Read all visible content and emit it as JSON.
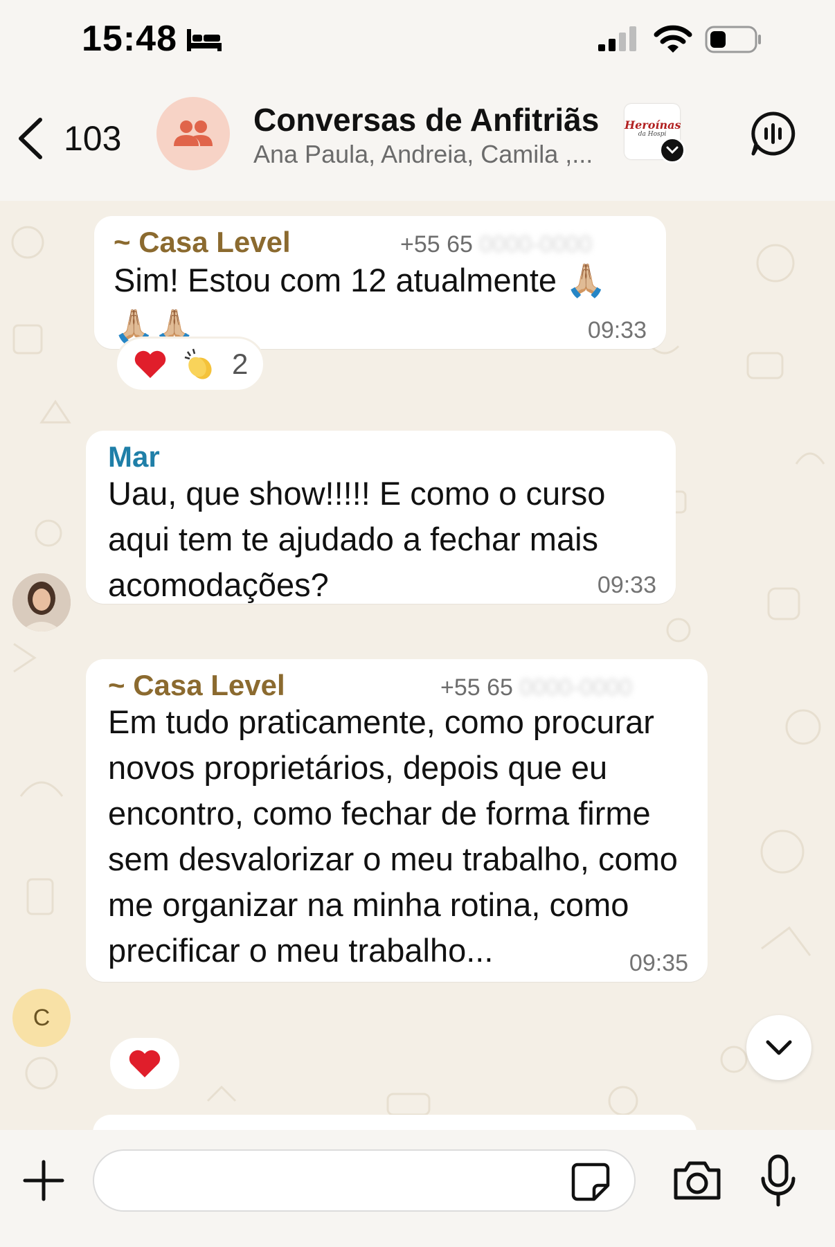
{
  "status_bar": {
    "time": "15:48"
  },
  "header": {
    "back_count": "103",
    "title": "Conversas de Anfitriãs",
    "members": "Ana Paula, Andreia, Camila ,...",
    "logo_text": "Heroínas",
    "logo_subtext": "da Hospi"
  },
  "messages": [
    {
      "sender": "~ Casa Level",
      "phone_visible": "+55 65 ",
      "phone_hidden": "0000-0000",
      "text": "Sim! Estou com 12 atualmente 🙏🏼 🙏🏼🙏🏼",
      "time": "09:33",
      "reactions": {
        "count": "2",
        "icons": [
          "heart-emoji",
          "clapping-emoji"
        ]
      }
    },
    {
      "sender": "Mar",
      "text": "Uau, que show!!!!! E como o curso aqui tem te ajudado a fechar mais acomodações?",
      "time": "09:33"
    },
    {
      "sender": "~ Casa Level",
      "phone_visible": "+55 65 ",
      "phone_hidden": "0000-0000",
      "text": "Em tudo praticamente, como procurar novos proprietários, depois que eu encontro, como fechar de forma firme sem desvalorizar o meu trabalho, como me organizar na minha rotina, como precificar o meu trabalho...",
      "time": "09:35",
      "reactions": {
        "icons": [
          "heart-emoji"
        ]
      }
    }
  ],
  "avatars": {
    "casa_level_initial": "C"
  },
  "input": {
    "value": "",
    "placeholder": ""
  },
  "colors": {
    "chat_background": "#f4efe6",
    "bar_background": "#f7f5f2",
    "casa_level_name": "#8b6a2f",
    "mar_name": "#1f7fa8",
    "group_avatar_bg": "#f7d3c6",
    "group_avatar_icon": "#e0644a"
  }
}
